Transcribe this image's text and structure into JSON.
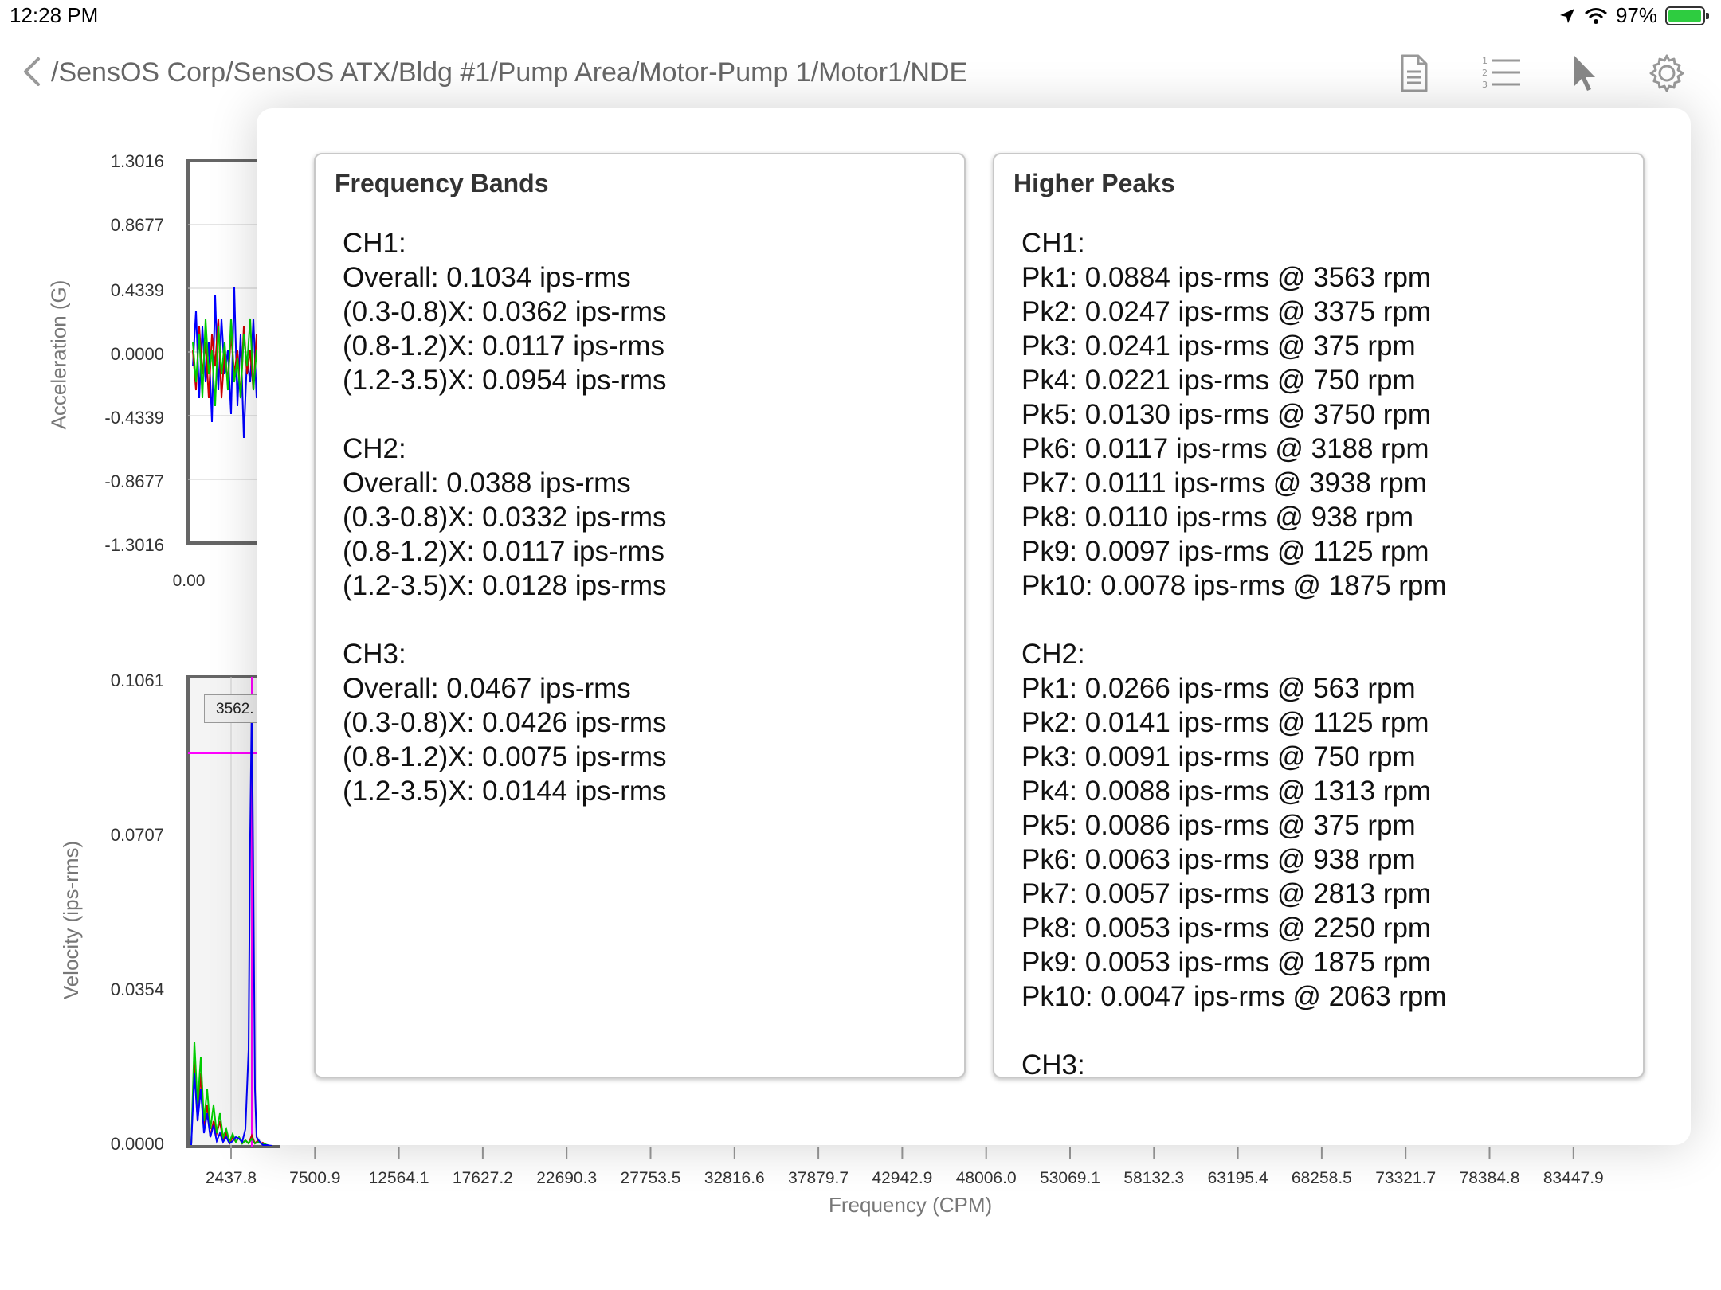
{
  "status_bar": {
    "time": "12:28 PM",
    "battery_label": "97%",
    "battery_level": 0.97
  },
  "nav": {
    "breadcrumb": "/SensOS Corp/SensOS ATX/Bldg #1/Pump Area/Motor-Pump 1/Motor1/NDE",
    "icons": [
      "back-chevron-icon",
      "document-icon",
      "numbered-list-icon",
      "cursor-arrow-icon",
      "gear-icon"
    ]
  },
  "background_chart": {
    "acceleration": {
      "ylabel": "Acceleration (G)",
      "yticks": [
        "1.3016",
        "0.8677",
        "0.4339",
        "0.0000",
        "-0.4339",
        "-0.8677",
        "-1.3016"
      ],
      "xtick_first": "0.00"
    },
    "velocity": {
      "ylabel": "Velocity (ips-rms)",
      "yticks": [
        "0.1061",
        "0.0707",
        "0.0354",
        "0.0000"
      ],
      "cursor_label": "3562.",
      "xlabel": "Frequency (CPM)",
      "xticks": [
        "2437.8",
        "7500.9",
        "12564.1",
        "17627.2",
        "22690.3",
        "27753.5",
        "32816.6",
        "37879.7",
        "42942.9",
        "48006.0",
        "53069.1",
        "58132.3",
        "63195.4",
        "68258.5",
        "73321.7",
        "78384.8",
        "83447.9"
      ]
    },
    "colors": {
      "ch1": "#0000ff",
      "ch2": "#cc0000",
      "ch3": "#00cc00",
      "cursor": "#ff00ff"
    }
  },
  "frequency_bands": {
    "title": "Frequency Bands",
    "groups": [
      {
        "name": "CH1:",
        "lines": [
          "Overall: 0.1034 ips-rms",
          "(0.3-0.8)X: 0.0362 ips-rms",
          "(0.8-1.2)X: 0.0117 ips-rms",
          "(1.2-3.5)X: 0.0954 ips-rms"
        ]
      },
      {
        "name": "CH2:",
        "lines": [
          "Overall: 0.0388 ips-rms",
          "(0.3-0.8)X: 0.0332 ips-rms",
          "(0.8-1.2)X: 0.0117 ips-rms",
          "(1.2-3.5)X: 0.0128 ips-rms"
        ]
      },
      {
        "name": "CH3:",
        "lines": [
          "Overall: 0.0467 ips-rms",
          "(0.3-0.8)X: 0.0426 ips-rms",
          "(0.8-1.2)X: 0.0075 ips-rms",
          "(1.2-3.5)X: 0.0144 ips-rms"
        ]
      }
    ]
  },
  "higher_peaks": {
    "title": "Higher Peaks",
    "groups": [
      {
        "name": "CH1:",
        "lines": [
          "Pk1: 0.0884 ips-rms @ 3563 rpm",
          "Pk2: 0.0247 ips-rms @ 3375 rpm",
          "Pk3: 0.0241 ips-rms @ 375 rpm",
          "Pk4: 0.0221 ips-rms @ 750 rpm",
          "Pk5: 0.0130 ips-rms @ 3750 rpm",
          "Pk6: 0.0117 ips-rms @ 3188 rpm",
          "Pk7: 0.0111 ips-rms @ 3938 rpm",
          "Pk8: 0.0110 ips-rms @ 938 rpm",
          "Pk9: 0.0097 ips-rms @ 1125 rpm",
          "Pk10: 0.0078 ips-rms @ 1875 rpm"
        ]
      },
      {
        "name": "CH2:",
        "lines": [
          "Pk1: 0.0266 ips-rms @ 563 rpm",
          "Pk2: 0.0141 ips-rms @ 1125 rpm",
          "Pk3: 0.0091 ips-rms @ 750 rpm",
          "Pk4: 0.0088 ips-rms @ 1313 rpm",
          "Pk5: 0.0086 ips-rms @ 375 rpm",
          "Pk6: 0.0063 ips-rms @ 938 rpm",
          "Pk7: 0.0057 ips-rms @ 2813 rpm",
          "Pk8: 0.0053 ips-rms @ 2250 rpm",
          "Pk9: 0.0053 ips-rms @ 1875 rpm",
          "Pk10: 0.0047 ips-rms @ 2063 rpm"
        ]
      },
      {
        "name": "CH3:",
        "lines": []
      }
    ]
  }
}
